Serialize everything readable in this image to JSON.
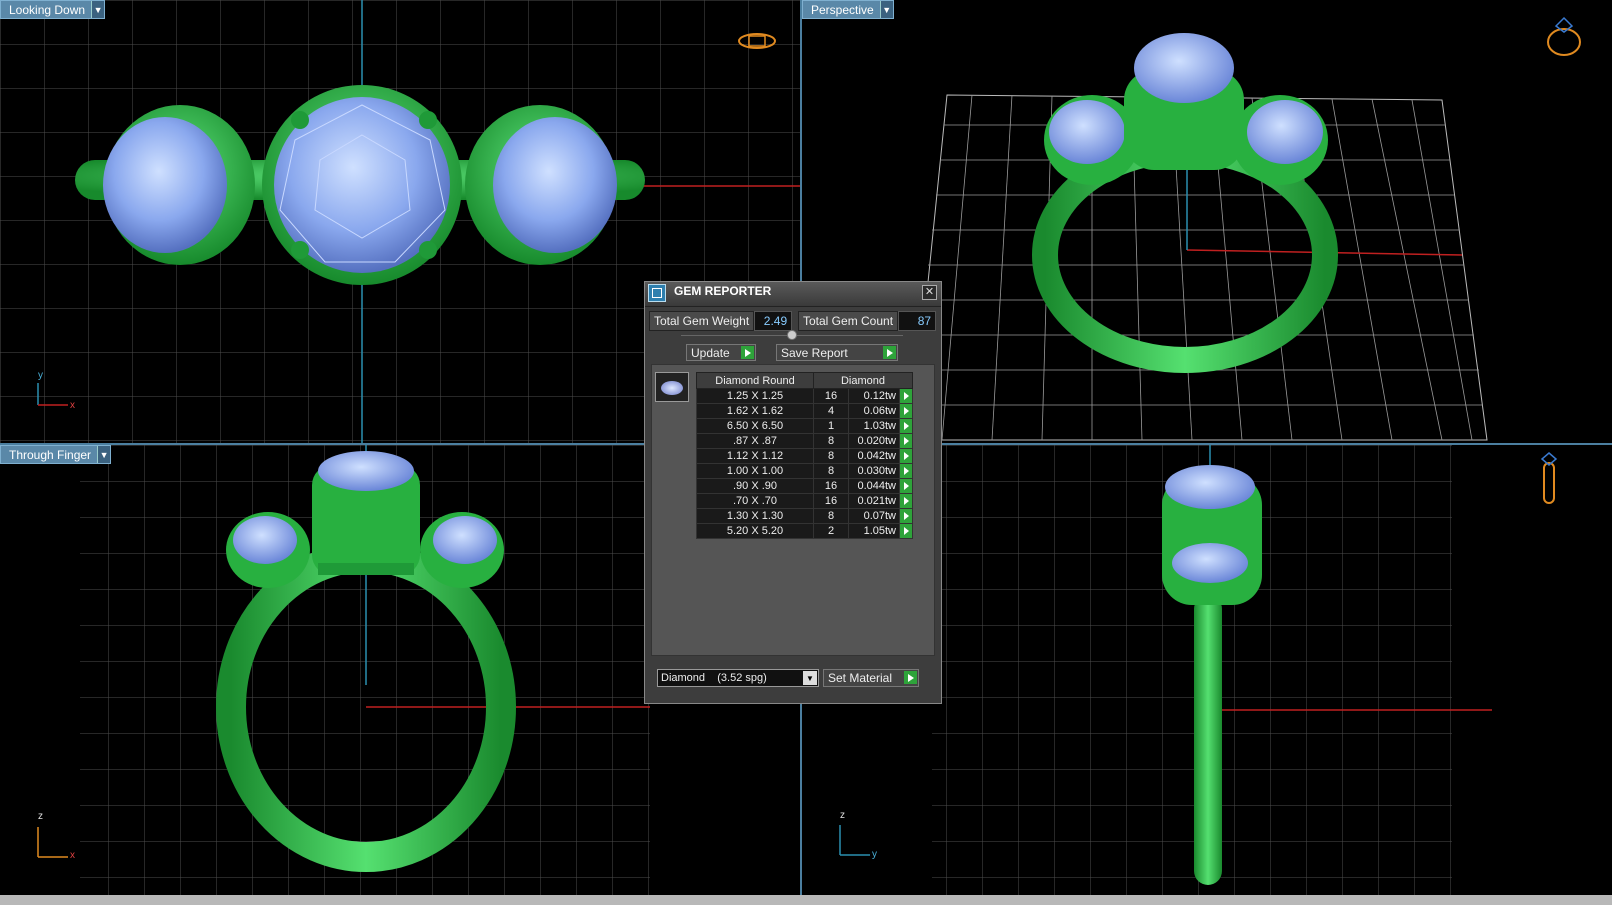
{
  "viewports": {
    "top_left": {
      "label": "Looking Down",
      "axis_v": "y",
      "axis_h": "x"
    },
    "top_right": {
      "label": "Perspective"
    },
    "bottom_left": {
      "label": "Through Finger",
      "axis_v": "z",
      "axis_h": "x"
    },
    "bottom_right": {
      "axis_v": "z",
      "axis_h": "y"
    }
  },
  "dialog": {
    "title": "GEM REPORTER",
    "close_glyph": "✕",
    "total_weight_label": "Total Gem Weight",
    "total_weight_value": "2.49",
    "total_count_label": "Total Gem Count",
    "total_count_value": "87",
    "update_label": "Update",
    "save_report_label": "Save Report",
    "table": {
      "headers": [
        "Diamond Round",
        "Diamond"
      ],
      "rows": [
        {
          "size": "1.25 X 1.25",
          "count": "16",
          "weight": "0.12tw"
        },
        {
          "size": "1.62 X 1.62",
          "count": "4",
          "weight": "0.06tw"
        },
        {
          "size": "6.50 X 6.50",
          "count": "1",
          "weight": "1.03tw"
        },
        {
          "size": ".87 X .87",
          "count": "8",
          "weight": "0.020tw"
        },
        {
          "size": "1.12 X 1.12",
          "count": "8",
          "weight": "0.042tw"
        },
        {
          "size": "1.00 X 1.00",
          "count": "8",
          "weight": "0.030tw"
        },
        {
          "size": ".90 X .90",
          "count": "16",
          "weight": "0.044tw"
        },
        {
          "size": ".70 X .70",
          "count": "16",
          "weight": "0.021tw"
        },
        {
          "size": "1.30 X 1.30",
          "count": "8",
          "weight": "0.07tw"
        },
        {
          "size": "5.20 X 5.20",
          "count": "2",
          "weight": "1.05tw"
        }
      ]
    },
    "material_select": "Diamond    (3.52 spg)",
    "set_material_label": "Set Material"
  },
  "colors": {
    "metal": "#2fbf4a",
    "gem": "#8fb0f0",
    "grid": "#5a5a5a",
    "axis_red": "#c02020",
    "axis_blue": "#2a8fb0",
    "label_bg": "#5a88a8",
    "icon_orange": "#e08a20"
  },
  "icons": {
    "top_left": "ring-orientation-icon",
    "top_right": "ring-perspective-icon",
    "bottom_right": "ring-side-icon"
  }
}
